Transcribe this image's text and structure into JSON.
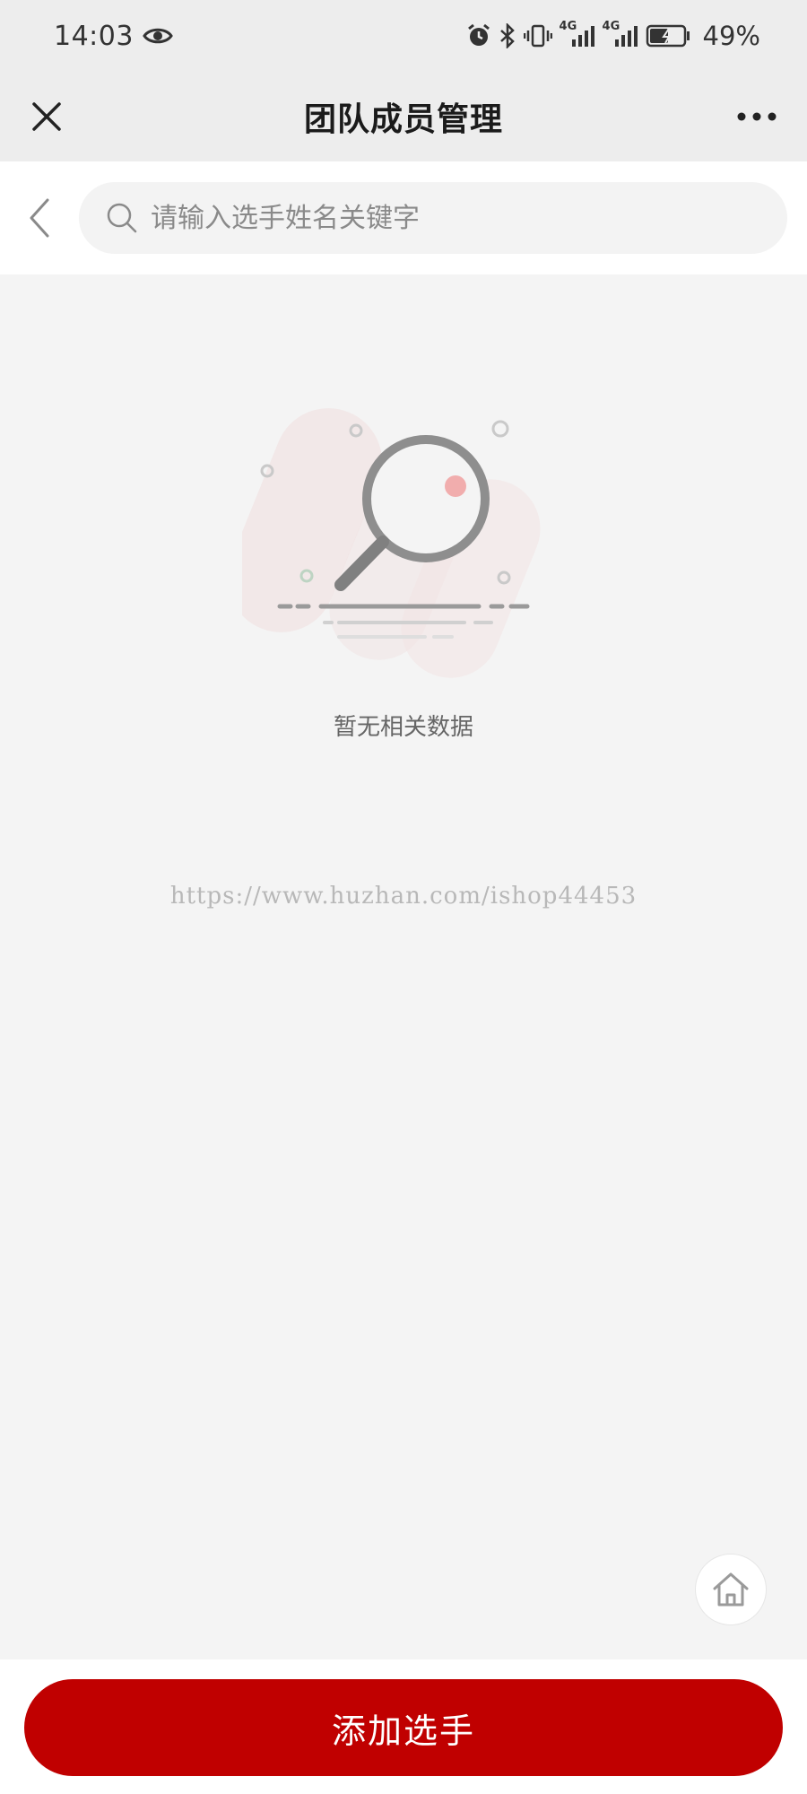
{
  "status_bar": {
    "time": "14:03",
    "network_1": "4G",
    "network_2": "4G",
    "battery_percent": "49%",
    "icons": [
      "eye-icon",
      "alarm-icon",
      "bluetooth-icon",
      "vibrate-icon",
      "signal-icon",
      "signal-icon",
      "battery-charging-icon"
    ]
  },
  "header": {
    "title": "团队成员管理",
    "close_icon": "close-icon",
    "more_icon": "more-icon"
  },
  "search": {
    "placeholder": "请输入选手姓名关键字",
    "value": ""
  },
  "empty_state": {
    "message": "暂无相关数据",
    "illustration": "magnifier-empty-illustration"
  },
  "watermark": {
    "text": "https://www.huzhan.com/ishop44453"
  },
  "floating": {
    "home_icon": "home-icon"
  },
  "footer": {
    "add_label": "添加选手"
  },
  "colors": {
    "primary": "#c00000",
    "background": "#f4f4f4",
    "header_bg": "#ededed"
  }
}
